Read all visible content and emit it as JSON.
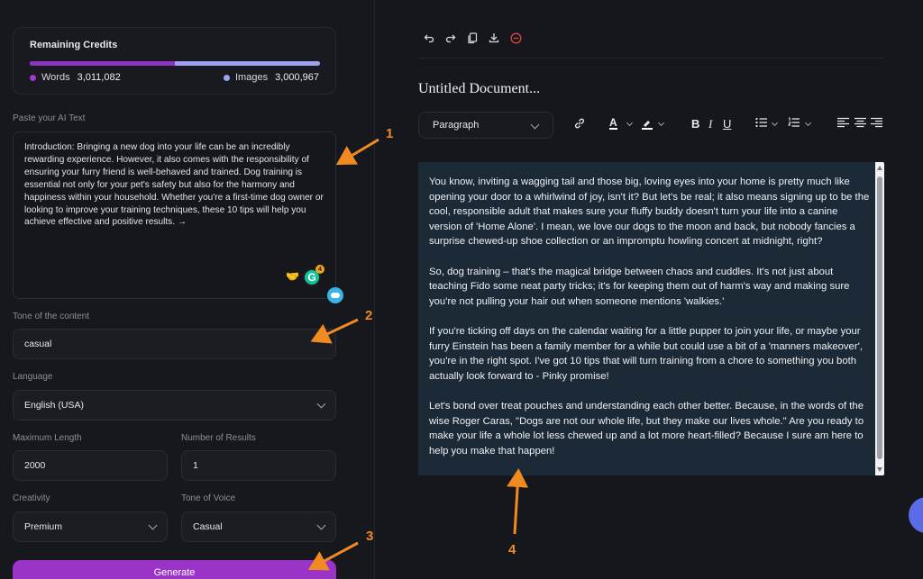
{
  "credits": {
    "title": "Remaining Credits",
    "words_label": "Words",
    "words_value": "3,011,082",
    "images_label": "Images",
    "images_value": "3,000,967",
    "words_color": "#8e32c4",
    "images_color": "#9da1f2",
    "words_fraction": 0.5008
  },
  "input": {
    "label": "Paste your AI Text",
    "text": "Introduction: Bringing a new dog into your life can be an incredibly rewarding experience. However, it also comes with the responsibility of ensuring your furry friend is well-behaved and trained. Dog training is essential not only for your pet's safety but also for the harmony and happiness within your household. Whether you're a first-time dog owner or looking to improve your training techniques, these 10 tips will help you achieve effective and positive results. →",
    "grammarly_badge": "4"
  },
  "tone": {
    "label": "Tone of the content",
    "value": "casual"
  },
  "language": {
    "label": "Language",
    "value": "English (USA)"
  },
  "max_length": {
    "label": "Maximum Length",
    "value": "2000"
  },
  "num_results": {
    "label": "Number of Results",
    "value": "1"
  },
  "creativity": {
    "label": "Creativity",
    "value": "Premium"
  },
  "tone_voice": {
    "label": "Tone of Voice",
    "value": "Casual"
  },
  "generate_label": "Generate",
  "editor": {
    "title": "Untitled Document...",
    "paragraph_select": "Paragraph",
    "paragraphs": [
      "You know, inviting a wagging tail and those big, loving eyes into your home is pretty much like opening your door to a whirlwind of joy, isn't it? But let's be real; it also means signing up to be the cool, responsible adult that makes sure your fluffy buddy doesn't turn your life into a canine version of 'Home Alone'. I mean, we love our dogs to the moon and back, but nobody fancies a surprise chewed-up shoe collection or an impromptu howling concert at midnight, right?",
      "So, dog training – that's the magical bridge between chaos and cuddles. It's not just about teaching Fido some neat party tricks; it's for keeping them out of harm's way and making sure you're not pulling your hair out when someone mentions 'walkies.'",
      "If you're ticking off days on the calendar waiting for a little pupper to join your life, or maybe your furry Einstein has been a family member for a while but could use a bit of a 'manners makeover', you're in the right spot. I've got 10 tips that will turn training from a chore to something you both actually look forward to - Pinky promise!",
      "Let's bond over treat pouches and understanding each other better. Because, in the words of the wise Roger Caras, \"Dogs are not our whole life, but they make our lives whole.\" Are you ready to make your life a whole lot less chewed up and a lot more heart-filled? Because I sure am here to help you make that happen!"
    ]
  },
  "annotations": [
    "1",
    "2",
    "3",
    "4"
  ],
  "accent_color": "#9a33c7",
  "annotation_color": "#f28a22"
}
